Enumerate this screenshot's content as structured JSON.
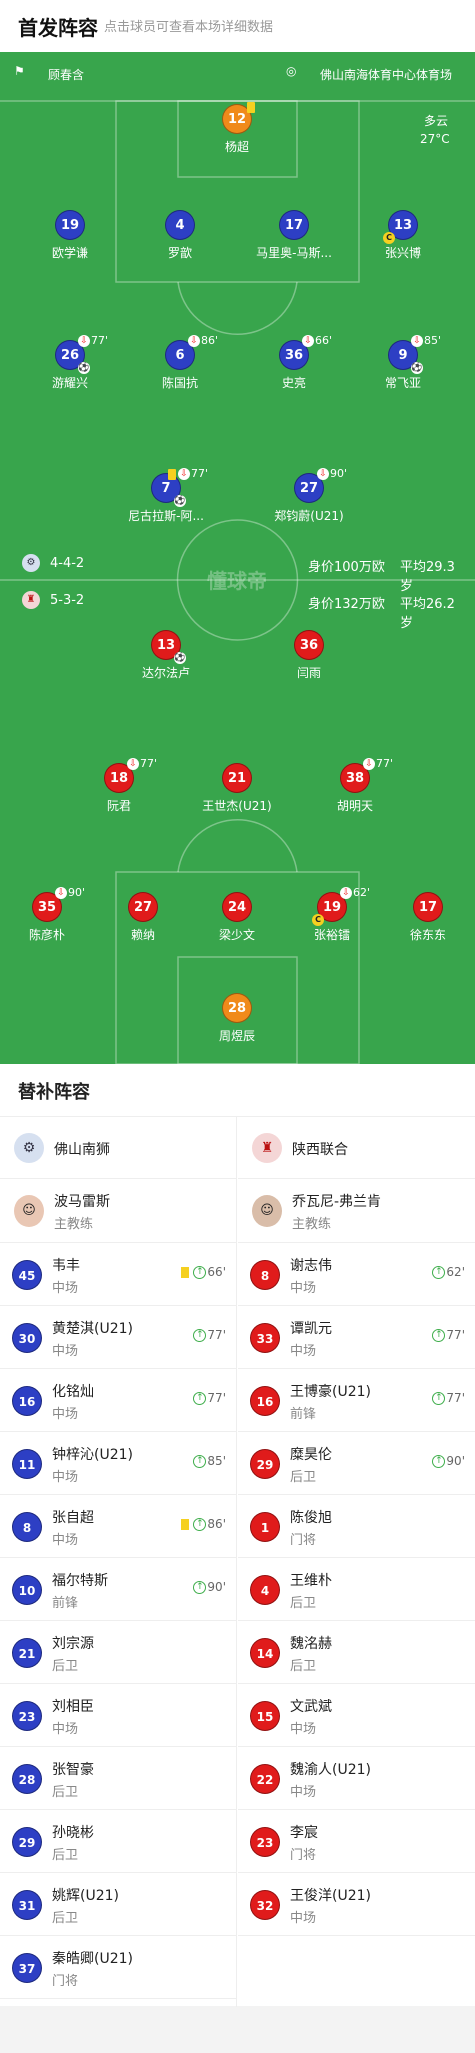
{
  "header": {
    "title": "首发阵容",
    "subtitle": "点击球员可查看本场详细数据"
  },
  "match_info": {
    "referee": "顾春含",
    "venue": "佛山南海体育中心体育场",
    "weather": "多云",
    "temperature": "27°C",
    "watermark": "懂球帝"
  },
  "home": {
    "formation": "4-4-2",
    "value": "身价100万欧",
    "avg_age": "平均29.3岁",
    "players": [
      {
        "num": "12",
        "name": "杨超",
        "color": "orange",
        "yellow": true
      },
      {
        "num": "19",
        "name": "欧学谦",
        "color": "blue"
      },
      {
        "num": "4",
        "name": "罗歆",
        "color": "blue"
      },
      {
        "num": "17",
        "name": "马里奥-马斯...",
        "color": "blue"
      },
      {
        "num": "13",
        "name": "张兴博",
        "color": "blue",
        "captain": true
      },
      {
        "num": "26",
        "name": "游耀兴",
        "color": "blue",
        "sub": "77'",
        "goal": true
      },
      {
        "num": "6",
        "name": "陈国抗",
        "color": "blue",
        "sub": "86'"
      },
      {
        "num": "36",
        "name": "史亮",
        "color": "blue",
        "sub": "66'"
      },
      {
        "num": "9",
        "name": "常飞亚",
        "color": "blue",
        "sub": "85'",
        "goal": true
      },
      {
        "num": "7",
        "name": "尼古拉斯-阿...",
        "color": "blue",
        "sub": "77'",
        "yellow": true,
        "goal": true
      },
      {
        "num": "27",
        "name": "郑钧蔚(U21)",
        "color": "blue",
        "sub": "90'"
      }
    ]
  },
  "away": {
    "formation": "5-3-2",
    "value": "身价132万欧",
    "avg_age": "平均26.2岁",
    "players": [
      {
        "num": "13",
        "name": "达尔法卢",
        "color": "red",
        "goal": true
      },
      {
        "num": "36",
        "name": "闫雨",
        "color": "red"
      },
      {
        "num": "18",
        "name": "阮君",
        "color": "red",
        "sub": "77'"
      },
      {
        "num": "21",
        "name": "王世杰(U21)",
        "color": "red"
      },
      {
        "num": "38",
        "name": "胡明天",
        "color": "red",
        "sub": "77'"
      },
      {
        "num": "35",
        "name": "陈彦朴",
        "color": "red",
        "sub": "90'"
      },
      {
        "num": "27",
        "name": "赖纳",
        "color": "red"
      },
      {
        "num": "24",
        "name": "梁少文",
        "color": "red"
      },
      {
        "num": "19",
        "name": "张裕镭",
        "color": "red",
        "sub": "62'",
        "captain": true
      },
      {
        "num": "17",
        "name": "徐东东",
        "color": "red"
      },
      {
        "num": "28",
        "name": "周煜辰",
        "color": "orange"
      }
    ]
  },
  "subs": {
    "title": "替补阵容",
    "home": {
      "team": "佛山南狮",
      "coach": {
        "name": "波马雷斯",
        "role": "主教练"
      },
      "players": [
        {
          "num": "45",
          "name": "韦丰",
          "pos": "中场",
          "in": "66'",
          "yellow": true
        },
        {
          "num": "30",
          "name": "黄楚淇(U21)",
          "pos": "中场",
          "in": "77'"
        },
        {
          "num": "16",
          "name": "化铭灿",
          "pos": "中场",
          "in": "77'"
        },
        {
          "num": "11",
          "name": "钟梓沁(U21)",
          "pos": "中场",
          "in": "85'"
        },
        {
          "num": "8",
          "name": "张自超",
          "pos": "中场",
          "in": "86'",
          "yellow": true
        },
        {
          "num": "10",
          "name": "福尔特斯",
          "pos": "前锋",
          "in": "90'"
        },
        {
          "num": "21",
          "name": "刘宗源",
          "pos": "后卫"
        },
        {
          "num": "23",
          "name": "刘相臣",
          "pos": "中场"
        },
        {
          "num": "28",
          "name": "张智豪",
          "pos": "后卫"
        },
        {
          "num": "29",
          "name": "孙晓彬",
          "pos": "后卫"
        },
        {
          "num": "31",
          "name": "姚辉(U21)",
          "pos": "后卫"
        },
        {
          "num": "37",
          "name": "秦皓卿(U21)",
          "pos": "门将"
        }
      ]
    },
    "away": {
      "team": "陕西联合",
      "coach": {
        "name": "乔瓦尼-弗兰肯",
        "role": "主教练"
      },
      "players": [
        {
          "num": "8",
          "name": "谢志伟",
          "pos": "中场",
          "in": "62'"
        },
        {
          "num": "33",
          "name": "谭凯元",
          "pos": "中场",
          "in": "77'"
        },
        {
          "num": "16",
          "name": "王博豪(U21)",
          "pos": "前锋",
          "in": "77'"
        },
        {
          "num": "29",
          "name": "糜昊伦",
          "pos": "后卫",
          "in": "90'"
        },
        {
          "num": "1",
          "name": "陈俊旭",
          "pos": "门将"
        },
        {
          "num": "4",
          "name": "王维朴",
          "pos": "后卫"
        },
        {
          "num": "14",
          "name": "魏洺赫",
          "pos": "后卫"
        },
        {
          "num": "15",
          "name": "文武斌",
          "pos": "中场"
        },
        {
          "num": "22",
          "name": "魏渝人(U21)",
          "pos": "中场"
        },
        {
          "num": "23",
          "name": "李宸",
          "pos": "门将"
        },
        {
          "num": "32",
          "name": "王俊洋(U21)",
          "pos": "中场"
        }
      ]
    }
  }
}
